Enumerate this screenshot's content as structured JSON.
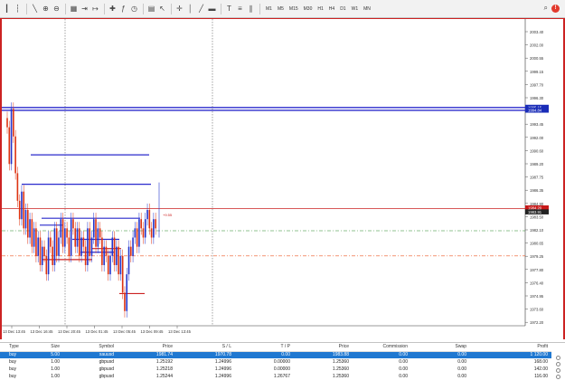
{
  "toolbar": {
    "icons": [
      "bar-chart-icon",
      "candle-chart-icon",
      "line-chart-icon",
      "zoom-in-icon",
      "zoom-out-icon",
      "tile-icon",
      "autoscroll-icon",
      "chart-shift-icon",
      "new-order-icon",
      "indicators-icon",
      "periods-icon",
      "templates-icon",
      "cursor-icon",
      "crosshair-icon",
      "vertical-line-icon",
      "trend-line-icon",
      "rectangle-icon",
      "text-label-icon",
      "fibonacci-icon",
      "equidistant-channel-icon"
    ],
    "timeframes": [
      "M1",
      "M5",
      "M15",
      "M30",
      "H1",
      "H4",
      "D1",
      "W1",
      "MN"
    ],
    "alert_count": "!"
  },
  "chart": {
    "price_labels": [
      "2003.40",
      "2002.00",
      "2000.55",
      "1999.15",
      "1997.70",
      "1996.30",
      "1994.85",
      "1993.45",
      "1992.00",
      "1990.60",
      "1989.20",
      "1987.75",
      "1986.35",
      "1984.90",
      "1983.50",
      "1982.10",
      "1980.65",
      "1979.25",
      "1977.80",
      "1976.40",
      "1974.95",
      "1973.60",
      "1972.20"
    ],
    "price_tags": [
      "1995.15",
      "1994.84",
      "1984.20",
      "1983.91"
    ],
    "profit_label": "+9.55",
    "time_labels": [
      "13 Dec 13:45",
      "13 Dec 16:45",
      "13 Dec 20:45",
      "13 Dec 01:45",
      "13 Dec 05:45",
      "13 Dec 09:45",
      "13 Dec 13:45"
    ],
    "colors": {
      "bull": "#2233cc",
      "bear": "#dd3311",
      "blue_line": "#2a2acc",
      "red_line": "#cc2222",
      "dash_green": "#228822",
      "dash_orange": "#ee5522"
    }
  },
  "terminal": {
    "columns": [
      "Type",
      "Size",
      "Symbol",
      "Price",
      "S / L",
      "T / P",
      "Price",
      "Commission",
      "Swap",
      "Profit"
    ],
    "rows": [
      {
        "type": "buy",
        "size": "5.00",
        "symbol": "xauusd",
        "price": "1981.74",
        "sl": "1970.78",
        "tp": "0.00",
        "cur": "1983.88",
        "comm": "0.00",
        "swap": "0.00",
        "profit": "1 120.00",
        "selected": true
      },
      {
        "type": "buy",
        "size": "1.00",
        "symbol": "gbpusd",
        "price": "1.25192",
        "sl": "1.24996",
        "tp": "0.00000",
        "cur": "1.25360",
        "comm": "0.00",
        "swap": "0.00",
        "profit": "168.00",
        "selected": false
      },
      {
        "type": "buy",
        "size": "1.00",
        "symbol": "gbpusd",
        "price": "1.25218",
        "sl": "1.24996",
        "tp": "0.00000",
        "cur": "1.25360",
        "comm": "0.00",
        "swap": "0.00",
        "profit": "142.00",
        "selected": false
      },
      {
        "type": "buy",
        "size": "1.00",
        "symbol": "gbpusd",
        "price": "1.25244",
        "sl": "1.24996",
        "tp": "1.26767",
        "cur": "1.25360",
        "comm": "0.00",
        "swap": "0.00",
        "profit": "116.00",
        "selected": false
      }
    ]
  }
}
